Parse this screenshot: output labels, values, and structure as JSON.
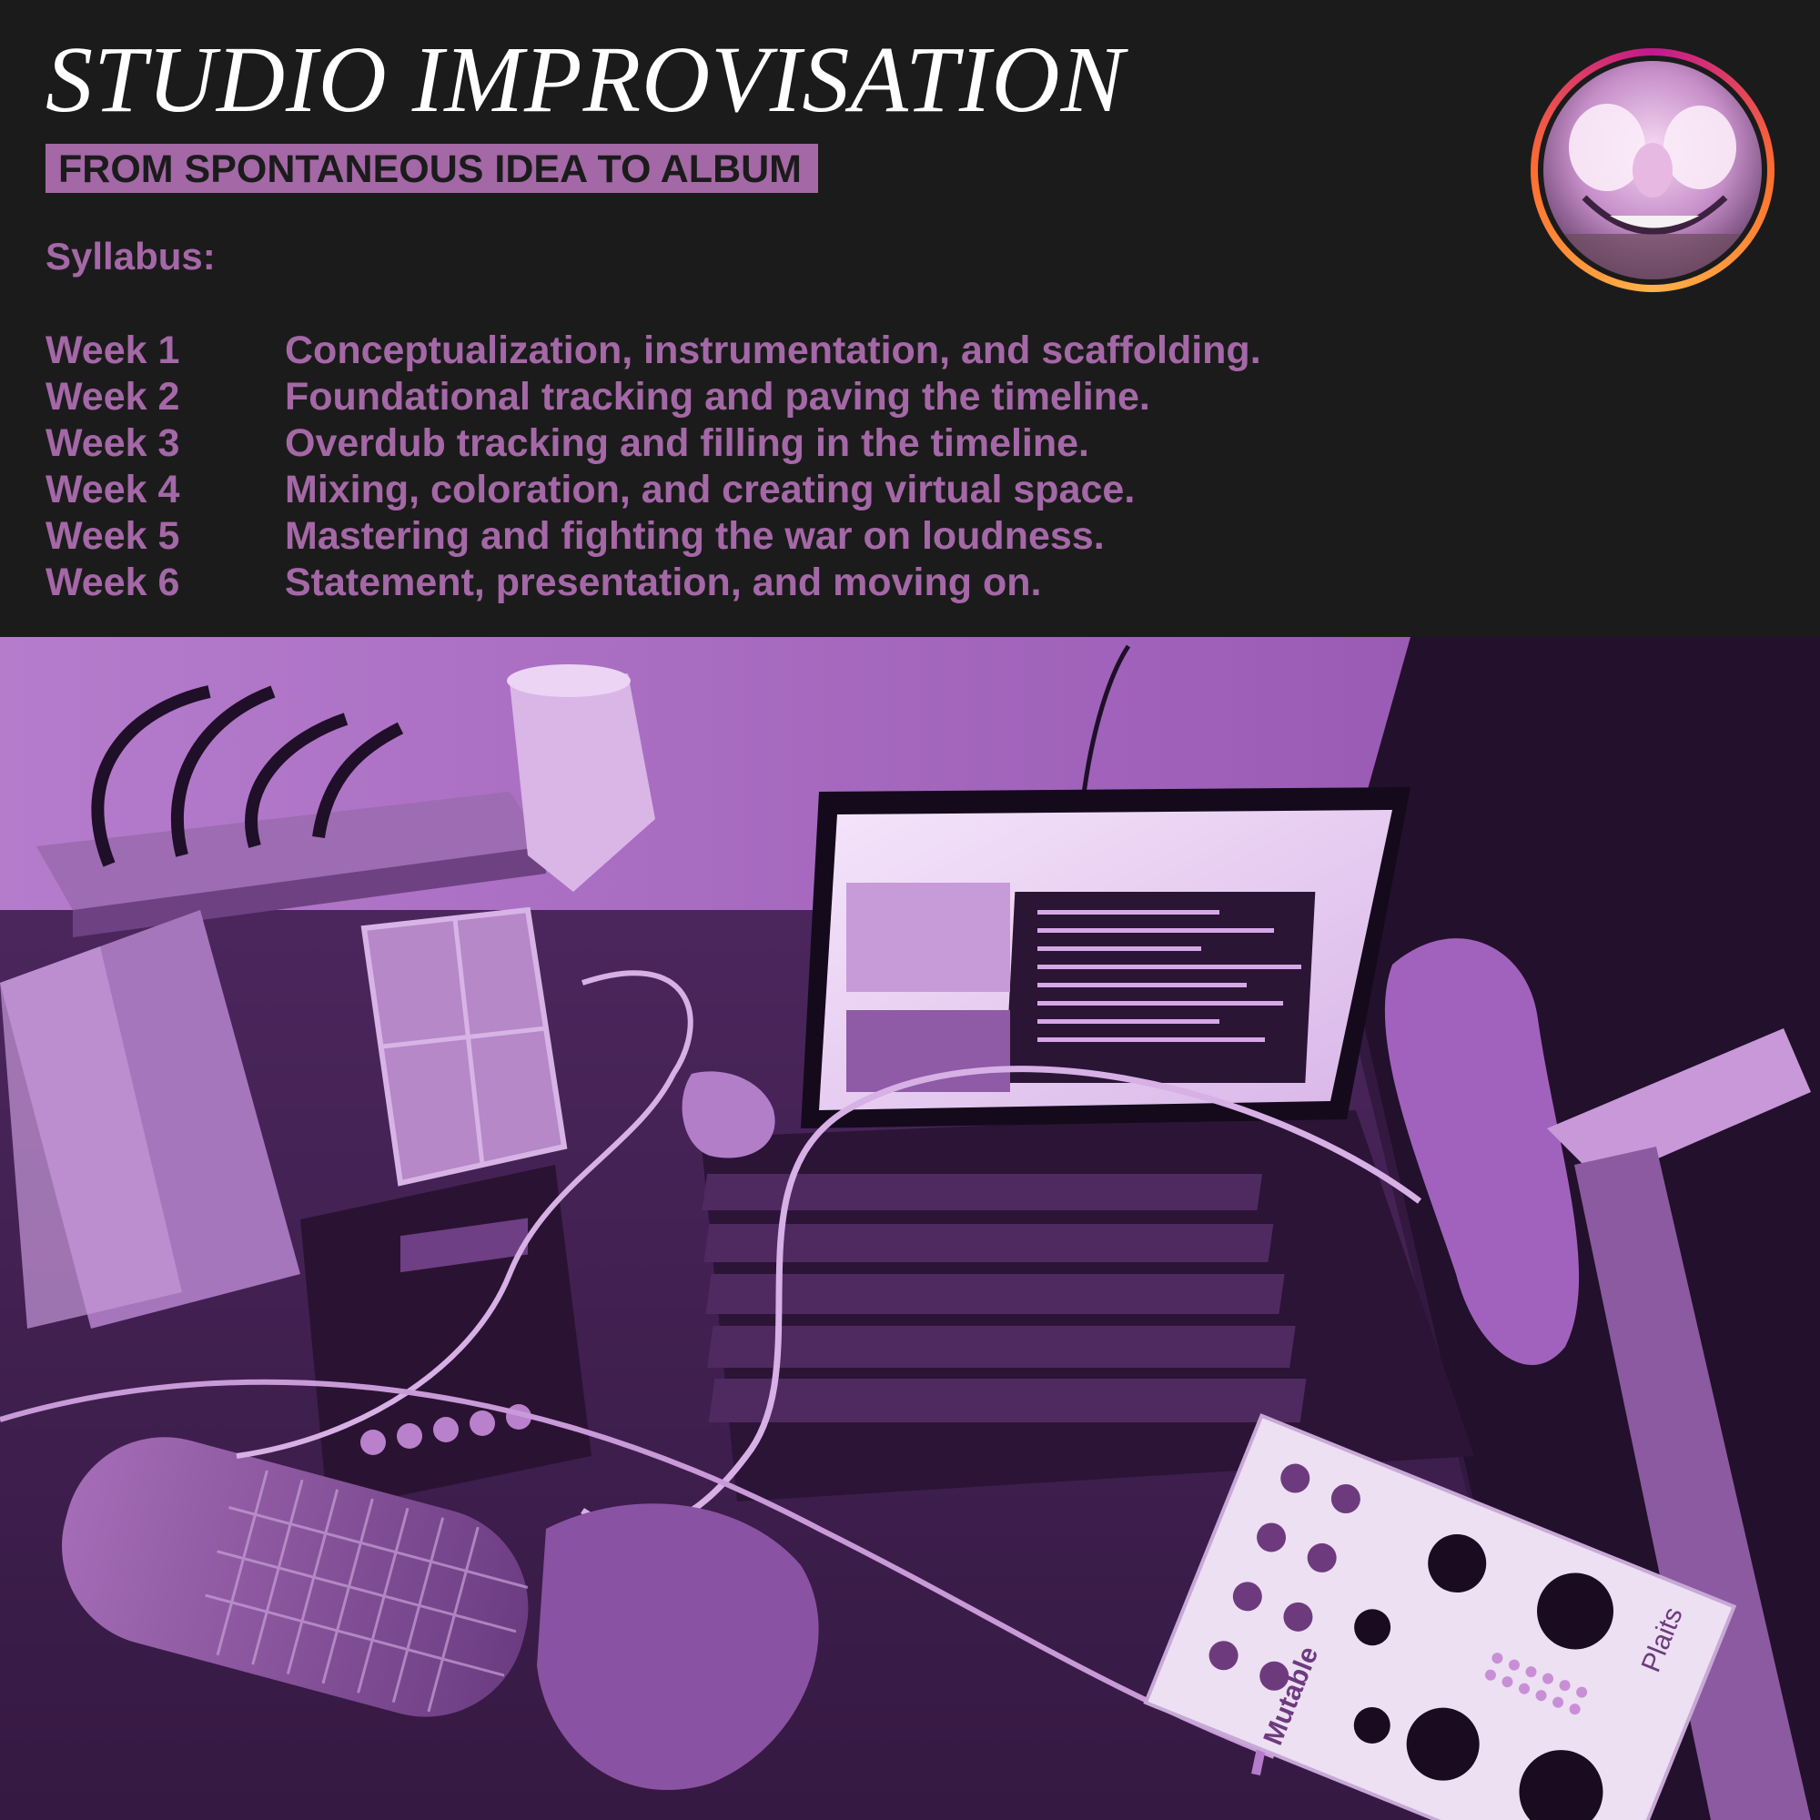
{
  "header": {
    "title": "STUDIO IMPROVISATION",
    "subtitle": "FROM SPONTANEOUS IDEA TO ALBUM",
    "syllabus_label": "Syllabus:"
  },
  "weeks": [
    {
      "label": "Week 1",
      "topic": "Conceptualization, instrumentation, and scaffolding."
    },
    {
      "label": "Week 2",
      "topic": "Foundational tracking and paving the timeline."
    },
    {
      "label": "Week 3",
      "topic": "Overdub tracking and filling in the timeline."
    },
    {
      "label": "Week 4",
      "topic": "Mixing, coloration, and creating virtual space."
    },
    {
      "label": "Week 5",
      "topic": "Mastering and fighting the war on loudness."
    },
    {
      "label": "Week 6",
      "topic": "Statement, presentation, and moving on."
    }
  ],
  "photo": {
    "module_brand": "Mutable",
    "module_name": "Plaits"
  },
  "colors": {
    "background": "#1c1b1c",
    "accent": "#a468a6",
    "title": "#ffffff",
    "avatar_ring_start": "#c2188f",
    "avatar_ring_end": "#ff6d2e",
    "photo_tint": "#7a3d98"
  }
}
